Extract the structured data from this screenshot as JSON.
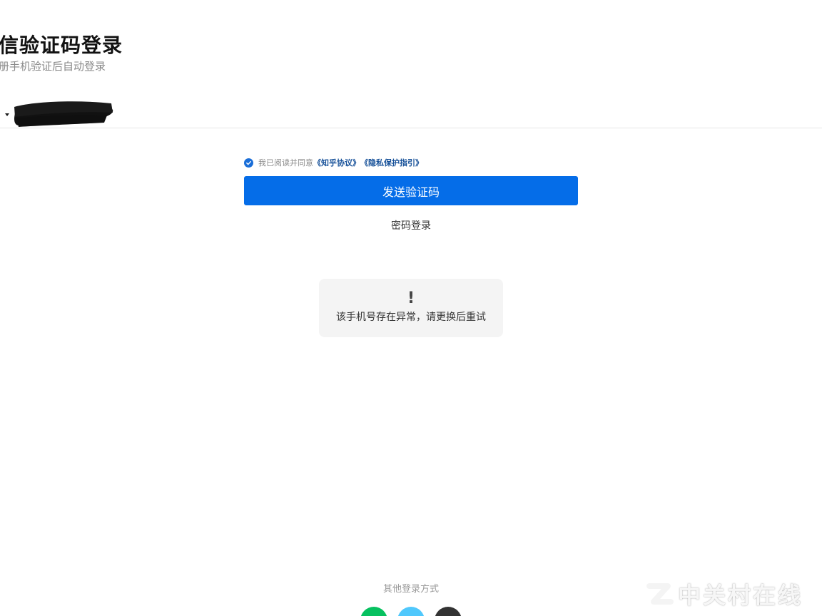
{
  "header": {
    "title": "信验证码登录",
    "subtitle": "册手机验证后自动登录"
  },
  "agreement": {
    "prefix": "我已阅读并同意",
    "link_terms": "《知乎协议》",
    "link_privacy": "《隐私保护指引》",
    "checked": true
  },
  "actions": {
    "send_code": "发送验证码",
    "password_login": "密码登录"
  },
  "toast": {
    "icon": "!",
    "message": "该手机号存在异常，请更换后重试"
  },
  "footer": {
    "other_login": "其他登录方式",
    "social": [
      "wechat-icon",
      "qq-icon",
      "weibo-icon"
    ]
  },
  "watermark": {
    "text": "中关村在线"
  },
  "colors": {
    "primary": "#056de8",
    "link": "#175199",
    "toast_bg": "#f4f4f4",
    "wechat": "#07c160",
    "qq": "#50c8fc",
    "weibo": "#333333"
  }
}
